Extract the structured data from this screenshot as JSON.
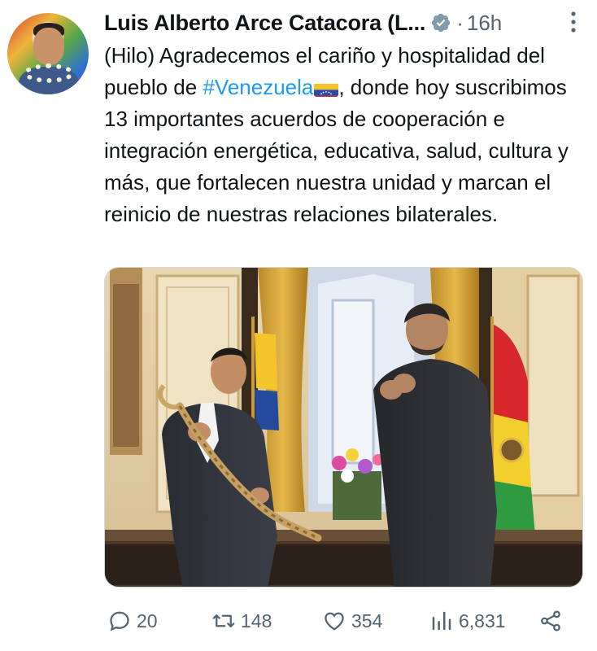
{
  "tweet": {
    "author_name": "Luis Alberto Arce Catacora (L...",
    "separator": "·",
    "time": "16h",
    "text_before": "(Hilo) Agradecemos el cariño y hospitalidad del pueblo de ",
    "hashtag": "#Venezuela",
    "text_after": ", donde hoy suscribimos 13 importantes acuerdos de cooperación e integración energética, educativa, salud, cultura y más, que fortalecen nuestra unidad y marcan el reinicio de nuestras relaciones bilaterales."
  },
  "icons": {
    "verified": "verified-badge-icon",
    "more": "more-dots-icon",
    "flag": "venezuela-flag-icon",
    "reply": "reply-icon",
    "retweet": "retweet-icon",
    "like": "heart-icon",
    "views": "views-chart-icon",
    "share": "share-icon"
  },
  "colors": {
    "text": "#0f1419",
    "muted": "#536471",
    "link": "#1d9bf0",
    "verified_badge": "#829aab"
  },
  "actions": {
    "reply_count": "20",
    "retweet_count": "148",
    "like_count": "354",
    "view_count": "6,831"
  }
}
